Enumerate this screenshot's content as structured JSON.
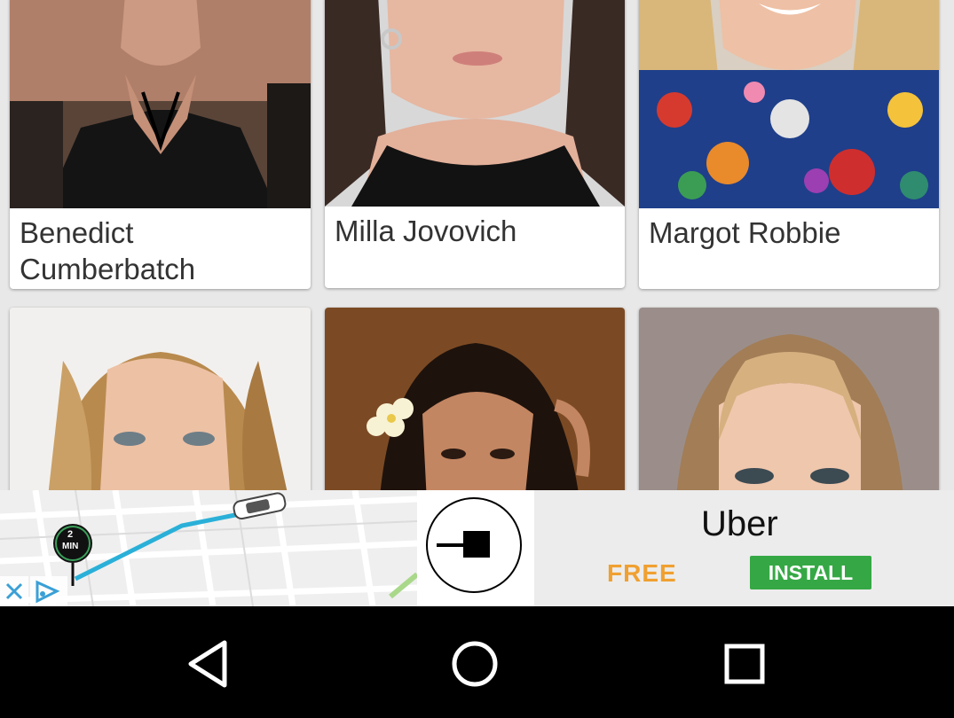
{
  "celebrities": [
    {
      "name": "Benedict Cumberbatch"
    },
    {
      "name": "Milla Jovovich"
    },
    {
      "name": "Margot Robbie"
    },
    {
      "name": ""
    },
    {
      "name": ""
    },
    {
      "name": ""
    }
  ],
  "ad": {
    "brand": "Uber",
    "price_label": "FREE",
    "install_label": "INSTALL",
    "eta_number": "2",
    "eta_unit": "MIN",
    "close_icon": "close-icon",
    "adchoices_icon": "adchoices-icon",
    "colors": {
      "install": "#35a845",
      "free": "#f0a030",
      "route": "#2ab0d8"
    }
  },
  "navbar": {
    "back_icon": "back-triangle-icon",
    "home_icon": "home-circle-icon",
    "recents_icon": "recents-square-icon"
  }
}
